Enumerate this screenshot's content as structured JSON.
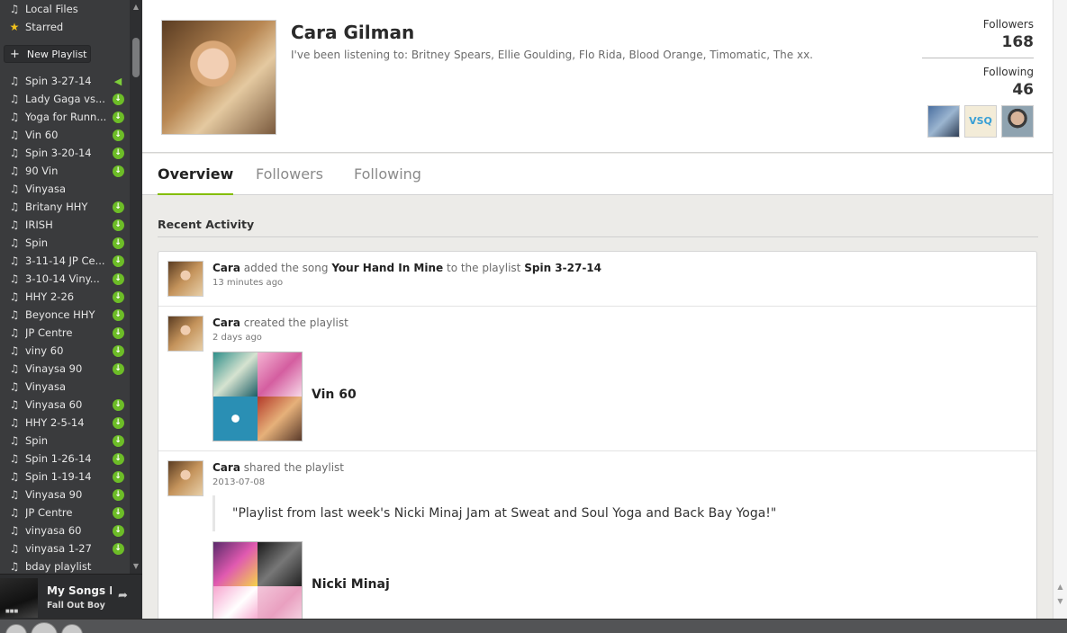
{
  "sidebar": {
    "top_items": [
      {
        "label": "Local Files",
        "icon": "file-icon"
      },
      {
        "label": "Starred",
        "icon": "star-icon"
      }
    ],
    "new_playlist_label": "New Playlist",
    "playlists": [
      {
        "label": "Spin 3-27-14",
        "status": "playing"
      },
      {
        "label": "Lady Gaga vs...",
        "status": "downloaded"
      },
      {
        "label": "Yoga for Runn...",
        "status": "downloaded"
      },
      {
        "label": "Vin 60",
        "status": "downloaded"
      },
      {
        "label": "Spin 3-20-14",
        "status": "downloaded"
      },
      {
        "label": "90 Vin",
        "status": "downloaded"
      },
      {
        "label": "Vinyasa",
        "status": "none"
      },
      {
        "label": "Britany HHY",
        "status": "downloaded"
      },
      {
        "label": "IRISH",
        "status": "downloaded"
      },
      {
        "label": "Spin",
        "status": "downloaded"
      },
      {
        "label": "3-11-14 JP Ce...",
        "status": "downloaded"
      },
      {
        "label": "3-10-14 Viny...",
        "status": "downloaded"
      },
      {
        "label": "HHY 2-26",
        "status": "downloaded"
      },
      {
        "label": "Beyonce HHY",
        "status": "downloaded"
      },
      {
        "label": "JP Centre",
        "status": "downloaded"
      },
      {
        "label": "viny 60",
        "status": "downloaded"
      },
      {
        "label": "Vinaysa 90",
        "status": "downloaded"
      },
      {
        "label": "Vinyasa",
        "status": "none"
      },
      {
        "label": "Vinyasa 60",
        "status": "downloaded"
      },
      {
        "label": "HHY 2-5-14",
        "status": "downloaded"
      },
      {
        "label": "Spin",
        "status": "downloaded"
      },
      {
        "label": "Spin 1-26-14",
        "status": "downloaded"
      },
      {
        "label": "Spin 1-19-14",
        "status": "downloaded"
      },
      {
        "label": "Vinyasa 90",
        "status": "downloaded"
      },
      {
        "label": "JP Centre",
        "status": "downloaded"
      },
      {
        "label": "vinyasa 60",
        "status": "downloaded"
      },
      {
        "label": "vinyasa 1-27",
        "status": "downloaded"
      },
      {
        "label": "bday playlist",
        "status": "none"
      }
    ]
  },
  "now_playing": {
    "title": "My Songs K",
    "artist": "Fall Out Boy"
  },
  "profile": {
    "name": "Cara Gilman",
    "listening": "I've been listening to: Britney Spears, Ellie Goulding, Flo Rida, Blood Orange, Timomatic, The xx.",
    "followers_label": "Followers",
    "followers_count": "168",
    "following_label": "Following",
    "following_count": "46"
  },
  "tabs": [
    {
      "label": "Overview",
      "active": true
    },
    {
      "label": "Followers",
      "active": false
    },
    {
      "label": "Following",
      "active": false
    }
  ],
  "recent_activity": {
    "title": "Recent Activity",
    "items": [
      {
        "user": "Cara",
        "action": "added the song",
        "song": "Your Hand In Mine",
        "connector": "to the playlist",
        "playlist": "Spin 3-27-14",
        "time": "13 minutes ago"
      },
      {
        "user": "Cara",
        "action": "created the playlist",
        "time": "2 days ago",
        "playlist_name": "Vin 60"
      },
      {
        "user": "Cara",
        "action": "shared the playlist",
        "time": "2013-07-08",
        "quote": "\"Playlist from last week's Nicki Minaj Jam at Sweat and Soul Yoga and Back Bay Yoga!\"",
        "playlist_name": "Nicki Minaj"
      }
    ]
  },
  "colors": {
    "accent_green": "#84bd00",
    "download_green": "#6dbd27",
    "sidebar_bg": "#3a3b3d"
  }
}
